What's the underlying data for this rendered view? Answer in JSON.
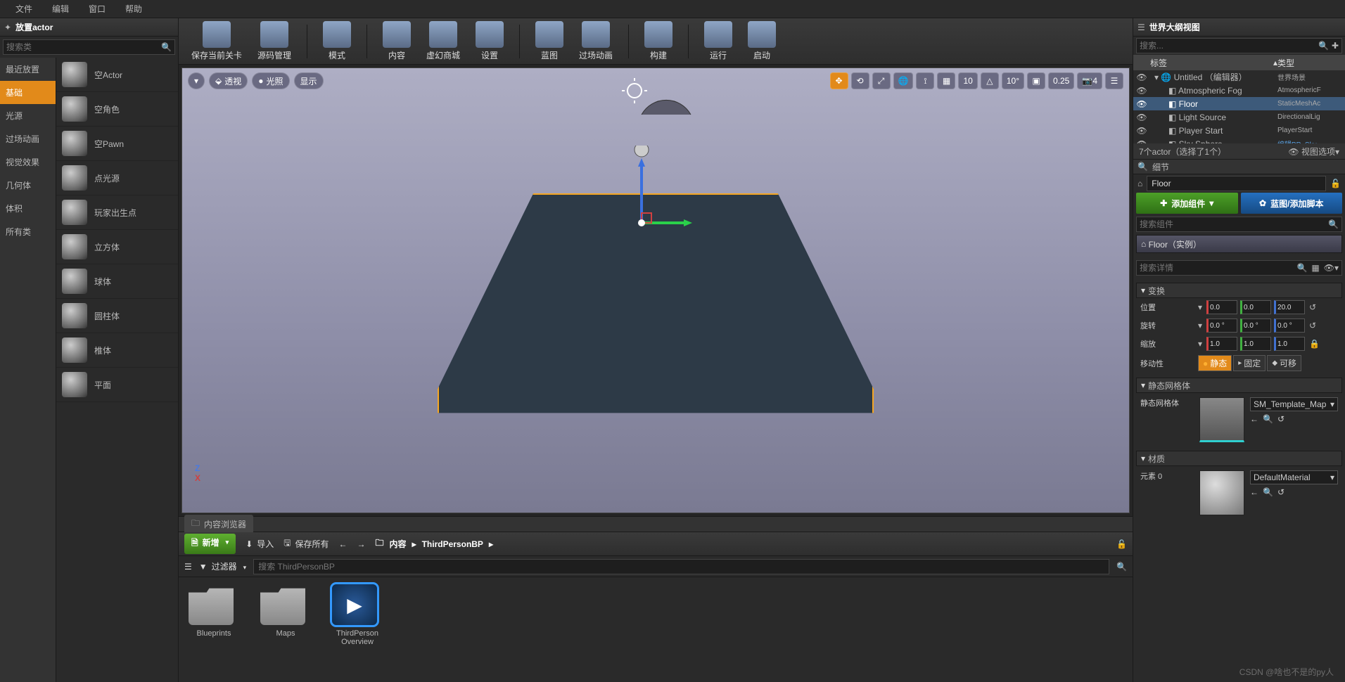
{
  "menu": {
    "file": "文件",
    "edit": "编辑",
    "window": "窗口",
    "help": "帮助"
  },
  "placeActors": {
    "title": "放置actor",
    "search_placeholder": "搜索类",
    "categories": [
      "最近放置",
      "基础",
      "光源",
      "过场动画",
      "视觉效果",
      "几何体",
      "体积",
      "所有类"
    ],
    "selected_index": 1,
    "items": [
      {
        "name": "空Actor"
      },
      {
        "name": "空角色"
      },
      {
        "name": "空Pawn"
      },
      {
        "name": "点光源"
      },
      {
        "name": "玩家出生点"
      },
      {
        "name": "立方体"
      },
      {
        "name": "球体"
      },
      {
        "name": "圆柱体"
      },
      {
        "name": "椎体"
      },
      {
        "name": "平面"
      }
    ]
  },
  "toolbar": [
    {
      "label": "保存当前关卡"
    },
    {
      "label": "源码管理"
    },
    {
      "sep": true
    },
    {
      "label": "模式"
    },
    {
      "sep": true
    },
    {
      "label": "内容"
    },
    {
      "label": "虚幻商城"
    },
    {
      "label": "设置"
    },
    {
      "sep": true
    },
    {
      "label": "蓝图"
    },
    {
      "label": "过场动画"
    },
    {
      "sep": true
    },
    {
      "label": "构建"
    },
    {
      "sep": true
    },
    {
      "label": "运行"
    },
    {
      "label": "启动"
    }
  ],
  "viewport": {
    "persp": "透视",
    "lit": "光照",
    "show": "显示",
    "right": {
      "snap_trans": "10",
      "snap_rot": "10°",
      "snap_scale": "0.25",
      "cam_speed": "4"
    }
  },
  "contentBrowser": {
    "tab": "内容浏览器",
    "newBtn": "新增",
    "import": "导入",
    "saveAll": "保存所有",
    "crumb_content": "内容",
    "crumb_folder": "ThirdPersonBP",
    "filter_label": "过滤器",
    "search_placeholder": "搜索 ThirdPersonBP",
    "assets": [
      {
        "name": "Blueprints",
        "type": "folder"
      },
      {
        "name": "Maps",
        "type": "folder"
      },
      {
        "name": "ThirdPerson\nOverview",
        "type": "bp",
        "selected": true
      }
    ]
  },
  "outliner": {
    "title": "世界大纲视图",
    "search_placeholder": "搜索...",
    "col_label": "标签",
    "col_type": "类型",
    "rows": [
      {
        "label": "Untitled （编辑器）",
        "type": "世界场景",
        "root": true
      },
      {
        "label": "Atmospheric Fog",
        "type": "AtmosphericF"
      },
      {
        "label": "Floor",
        "type": "StaticMeshAc",
        "selected": true
      },
      {
        "label": "Light Source",
        "type": "DirectionalLig"
      },
      {
        "label": "Player Start",
        "type": "PlayerStart"
      },
      {
        "label": "Sky Sphere",
        "type": "编辑BP_Sky",
        "link": true
      }
    ],
    "status_count": "7个actor（选择了1个）",
    "view_options": "视图选项"
  },
  "details": {
    "title": "细节",
    "selected": "Floor",
    "addComponent": "添加组件",
    "bpScript": "蓝图/添加脚本",
    "search_comp_placeholder": "搜索组件",
    "root_comp": "Floor（实例）",
    "search_detail_placeholder": "搜索详情",
    "transform_hdr": "变换",
    "loc": "位置",
    "rot": "旋转",
    "scale": "缩放",
    "mobility": "移动性",
    "loc_x": "0.0",
    "loc_y": "0.0",
    "loc_z": "20.0",
    "rot_x": "0.0 °",
    "rot_y": "0.0 °",
    "rot_z": "0.0 °",
    "scl_x": "1.0",
    "scl_y": "1.0",
    "scl_z": "1.0",
    "mob_static": "静态",
    "mob_station": "固定",
    "mob_move": "可移",
    "reset": "↺",
    "static_mesh_hdr": "静态网格体",
    "static_mesh_label": "静态网格体",
    "mesh_name": "SM_Template_Map",
    "material_hdr": "材质",
    "element0": "元素 0",
    "material_name": "DefaultMaterial"
  },
  "watermark": "CSDN @啥也不是的py人"
}
